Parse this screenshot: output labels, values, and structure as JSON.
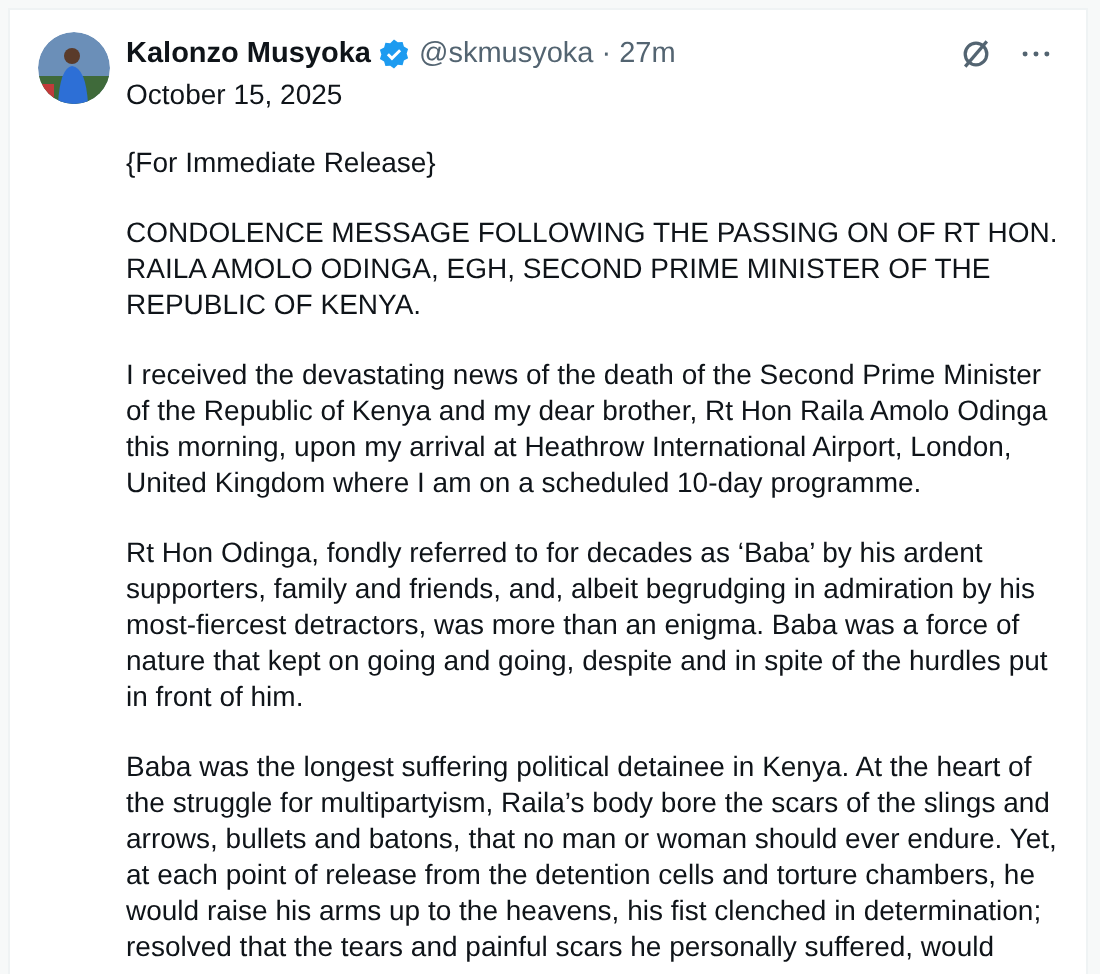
{
  "post": {
    "author": "Kalonzo Musyoka",
    "verified": true,
    "handle": "@skmusyoka",
    "separator": "·",
    "time": "27m",
    "paragraphs": [
      "October 15, 2025",
      "{For Immediate Release}",
      "CONDOLENCE MESSAGE FOLLOWING THE PASSING ON OF RT HON.\nRAILA AMOLO ODINGA, EGH, SECOND PRIME MINISTER OF THE\nREPUBLIC OF KENYA.",
      "I received the devastating news of the death of the Second Prime Minister\nof the Republic of Kenya and my dear brother, Rt Hon Raila Amolo Odinga\nthis morning, upon my arrival at Heathrow International Airport, London,\nUnited Kingdom where I am on a scheduled 10-day programme.",
      "Rt Hon Odinga, fondly referred to for decades as ‘Baba’ by his ardent\nsupporters, family and friends, and, albeit begrudging in admiration by his\nmost-fiercest detractors, was more than an enigma. Baba was a force of\nnature that kept on going and going, despite and in spite of the hurdles put\nin front of him.",
      "Baba was the longest suffering political detainee in Kenya. At the heart of\nthe struggle for multipartyism, Raila’s body bore the scars of the slings and\narrows, bullets and batons, that no man or woman should ever endure. Yet,\nat each point of release from the detention cells and torture chambers, he\nwould raise his arms up to the heavens, his fist clenched in determination;\nresolved that the tears and painful scars he personally suffered, would"
    ]
  }
}
